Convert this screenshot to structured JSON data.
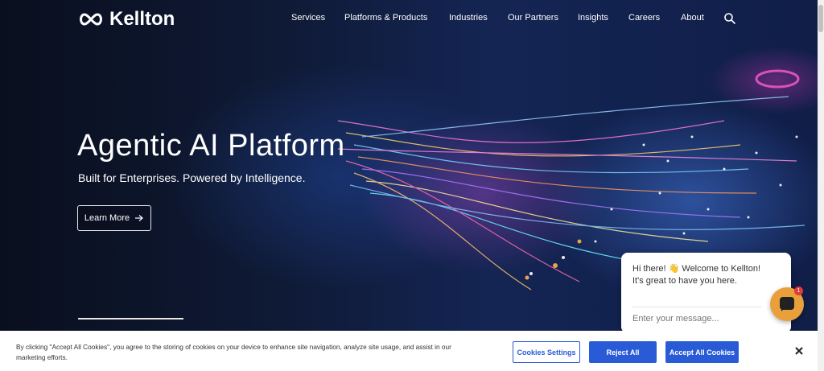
{
  "header": {
    "logo_text": "Kellton",
    "nav_items": [
      "Services",
      "Platforms & Products",
      "Industries",
      "Our Partners",
      "Insights",
      "Careers",
      "About"
    ]
  },
  "hero": {
    "title": "Agentic AI Platform",
    "subtitle": "Built for Enterprises. Powered by Intelligence.",
    "cta_label": "Learn More"
  },
  "chat": {
    "greeting": "Hi there! 👋 Welcome to Kellton! It's great to have you here.",
    "input_placeholder": "Enter your message...",
    "badge_count": "1"
  },
  "cookie": {
    "text": "By clicking \"Accept All Cookies\", you agree to the storing of cookies on your device to enhance site navigation, analyze site usage, and assist in our marketing efforts.",
    "settings_label": "Cookies Settings",
    "reject_label": "Reject All",
    "accept_label": "Accept All Cookies"
  },
  "colors": {
    "accent_blue": "#2a5bd7",
    "chat_launcher": "#e9a03b",
    "badge_red": "#e03a3a"
  },
  "icons": {
    "search": "search-icon",
    "arrow": "arrow-right-icon",
    "close": "close-icon",
    "chat": "chat-icon"
  }
}
